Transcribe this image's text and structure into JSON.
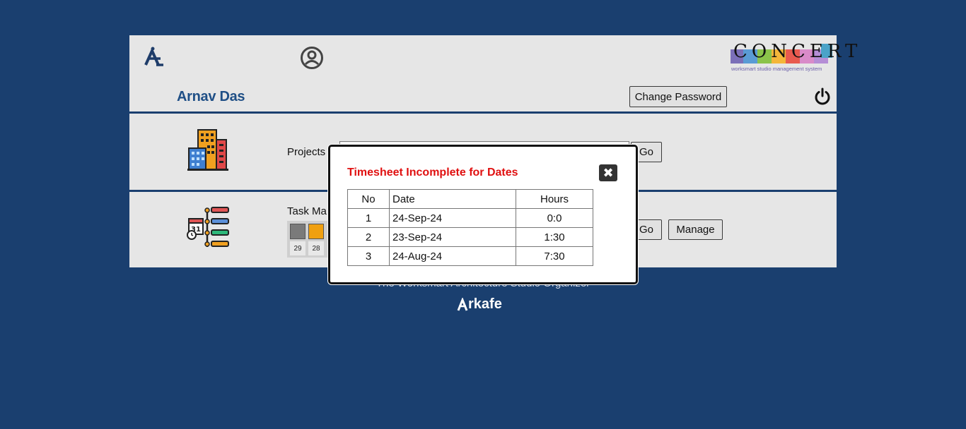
{
  "header": {
    "user_name": "Arnav Das",
    "change_password_label": "Change Password",
    "logo_text": "CONCERT",
    "logo_tagline": "worksmart studio management system",
    "icons": [
      "arkafe-home-icon",
      "user-profile-icon",
      "power-icon"
    ]
  },
  "projects": {
    "label": "Projects",
    "go_label": "Go",
    "icon": "buildings-icon"
  },
  "tasks": {
    "label": "Task Ma",
    "go_label": "Go",
    "manage_label": "Manage",
    "icon": "task-timeline-icon",
    "status_colors": [
      "#7a7a7a",
      "#f0a010"
    ],
    "status_counts": [
      "29",
      "28"
    ]
  },
  "footer": {
    "tagline": "The Worksmart Architecture Studio Organizer",
    "brand": "rkafe"
  },
  "modal": {
    "title": "Timesheet Incomplete for Dates",
    "close_label": "✖",
    "columns": {
      "no": "No",
      "date": "Date",
      "hours": "Hours"
    },
    "rows": [
      {
        "no": "1",
        "date": "24-Sep-24",
        "hours": "0:0"
      },
      {
        "no": "2",
        "date": "23-Sep-24",
        "hours": "1:30"
      },
      {
        "no": "3",
        "date": "24-Aug-24",
        "hours": "7:30"
      }
    ]
  },
  "colors": {
    "background": "#1a3f6f",
    "panel": "#e6e6e6",
    "user_name": "#1f4f86",
    "modal_title": "#e01010"
  }
}
